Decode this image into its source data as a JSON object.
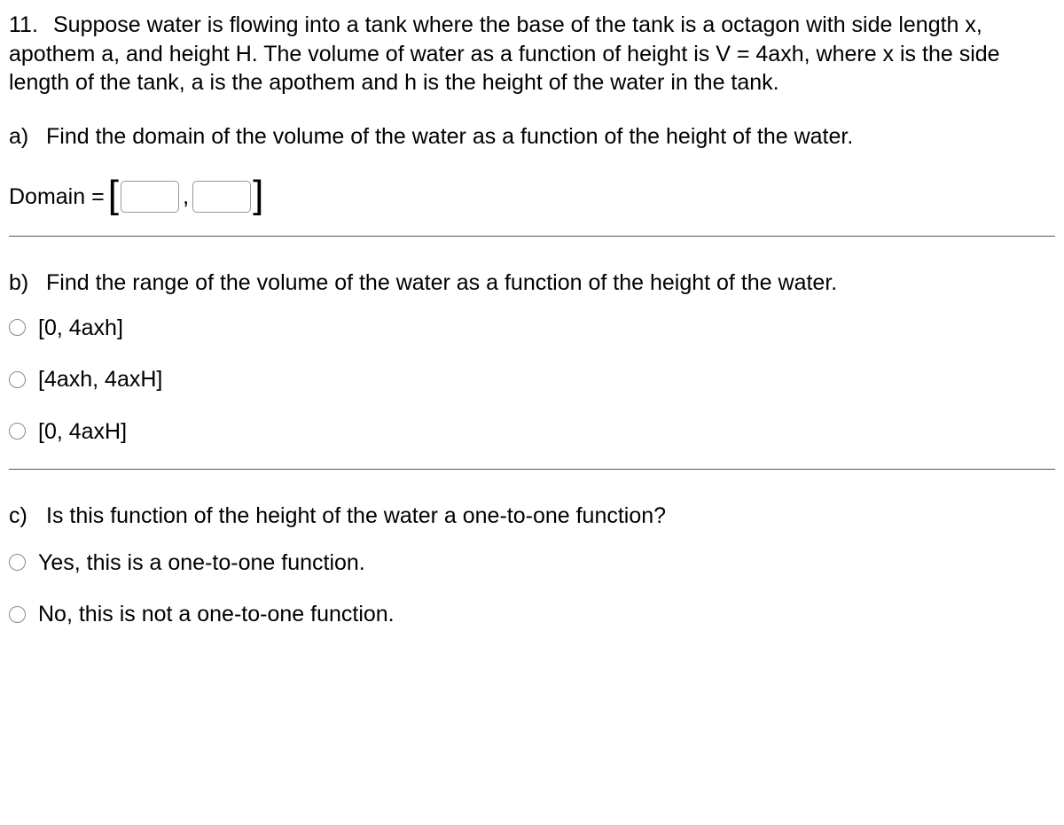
{
  "question": {
    "number": "11.",
    "text": "Suppose water is flowing into a tank where the base of the tank is a octagon with side length x, apothem a, and height H. The volume of water as a function of height is V = 4axh, where x is the side length of the tank, a is the apothem and h is the height of the water in the tank."
  },
  "partA": {
    "label": "a)",
    "text": "Find the domain of the volume of the water as a function of the height of the water.",
    "domainLabel": "Domain =",
    "leftBracket": "[",
    "comma": ",",
    "rightBracket": "]",
    "input1": "",
    "input2": ""
  },
  "partB": {
    "label": "b)",
    "text": "Find the range of the volume of the water as a function of the height of the water.",
    "options": [
      "[0, 4axh]",
      "[4axh, 4axH]",
      "[0, 4axH]"
    ]
  },
  "partC": {
    "label": "c)",
    "text": "Is this function of the height of the water a one-to-one function?",
    "options": [
      "Yes, this is a one-to-one function.",
      "No, this is not a one-to-one function."
    ]
  }
}
